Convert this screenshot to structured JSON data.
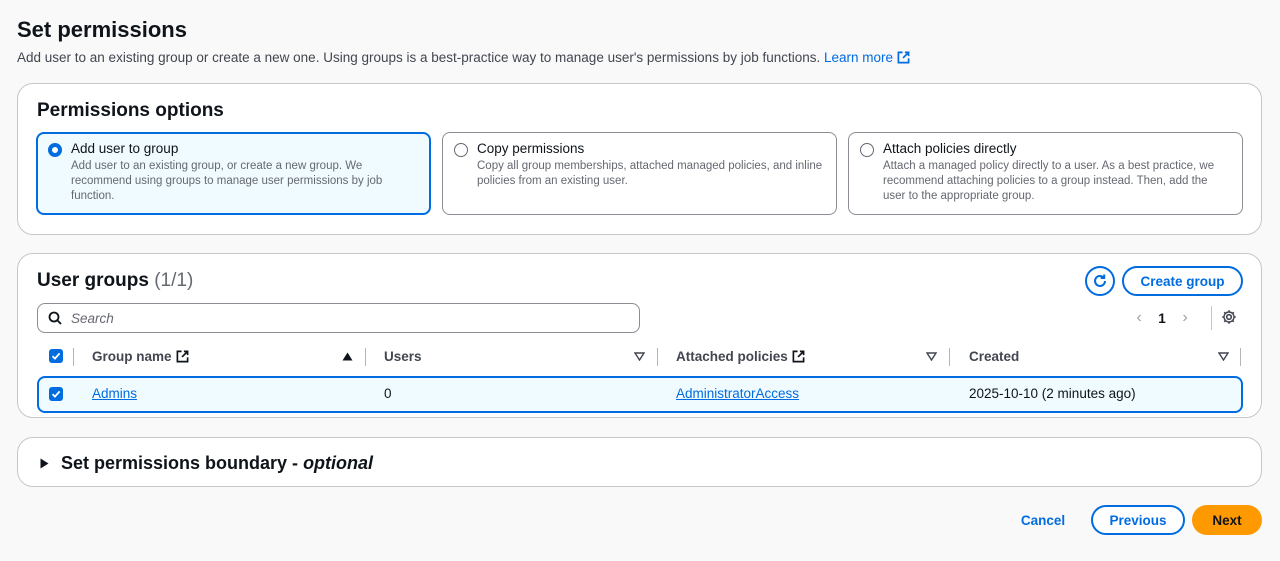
{
  "header": {
    "title": "Set permissions",
    "description": "Add user to an existing group or create a new one. Using groups is a best-practice way to manage user's permissions by job functions.",
    "learn_more": "Learn more"
  },
  "permissions_options": {
    "title": "Permissions options",
    "selected": "add_user_to_group",
    "options": [
      {
        "label": "Add user to group",
        "description": "Add user to an existing group, or create a new group. We recommend using groups to manage user permissions by job function."
      },
      {
        "label": "Copy permissions",
        "description": "Copy all group memberships, attached managed policies, and inline policies from an existing user."
      },
      {
        "label": "Attach policies directly",
        "description": "Attach a managed policy directly to a user. As a best practice, we recommend attaching policies to a group instead. Then, add the user to the appropriate group."
      }
    ]
  },
  "user_groups": {
    "title": "User groups",
    "count": "(1/1)",
    "create_label": "Create group",
    "search_placeholder": "Search",
    "page": "1",
    "columns": [
      "Group name",
      "Users",
      "Attached policies",
      "Created"
    ],
    "rows": [
      {
        "group_name": "Admins",
        "users": "0",
        "attached_policies": "AdministratorAccess",
        "created": "2025-10-10 (2 minutes ago)",
        "selected": true
      }
    ]
  },
  "boundary": {
    "title": "Set permissions boundary - ",
    "optional": "optional"
  },
  "footer": {
    "cancel": "Cancel",
    "previous": "Previous",
    "next": "Next"
  },
  "colors": {
    "accent": "#006ce0",
    "primary_button": "#ff9900",
    "selected_bg": "#f0fbff"
  },
  "icons": [
    "external-link-icon",
    "radio-selected-icon",
    "radio-icon",
    "refresh-icon",
    "search-icon",
    "chevron-left-icon",
    "chevron-right-icon",
    "settings-icon",
    "sort-ascending-icon",
    "sort-descending-icon",
    "checkbox-checked-icon",
    "caret-right-icon"
  ]
}
